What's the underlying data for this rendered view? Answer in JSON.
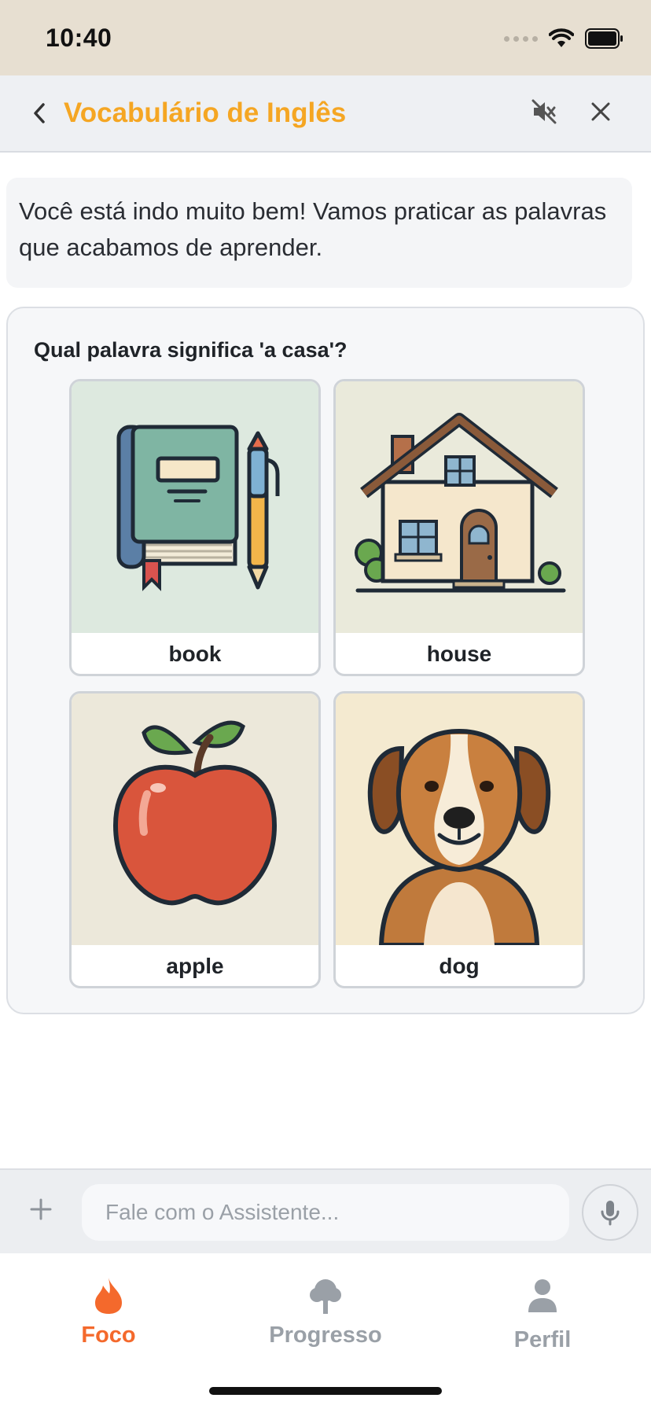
{
  "status_bar": {
    "time": "10:40"
  },
  "header": {
    "title": "Vocabulário de Inglês"
  },
  "message": {
    "text": "Você está indo muito bem! Vamos praticar as palavras que acabamos de aprender."
  },
  "quiz": {
    "question": "Qual palavra significa 'a casa'?",
    "options": [
      {
        "label": "book",
        "icon": "book-icon"
      },
      {
        "label": "house",
        "icon": "house-icon"
      },
      {
        "label": "apple",
        "icon": "apple-icon"
      },
      {
        "label": "dog",
        "icon": "dog-icon"
      }
    ]
  },
  "input": {
    "placeholder": "Fale com o Assistente..."
  },
  "tabs": [
    {
      "label": "Foco",
      "icon": "flame-icon",
      "active": true
    },
    {
      "label": "Progresso",
      "icon": "tree-icon",
      "active": false
    },
    {
      "label": "Perfil",
      "icon": "person-icon",
      "active": false
    }
  ],
  "colors": {
    "accent_title": "#f5a623",
    "accent_tab": "#f4692c",
    "inactive": "#9aa0a7"
  }
}
